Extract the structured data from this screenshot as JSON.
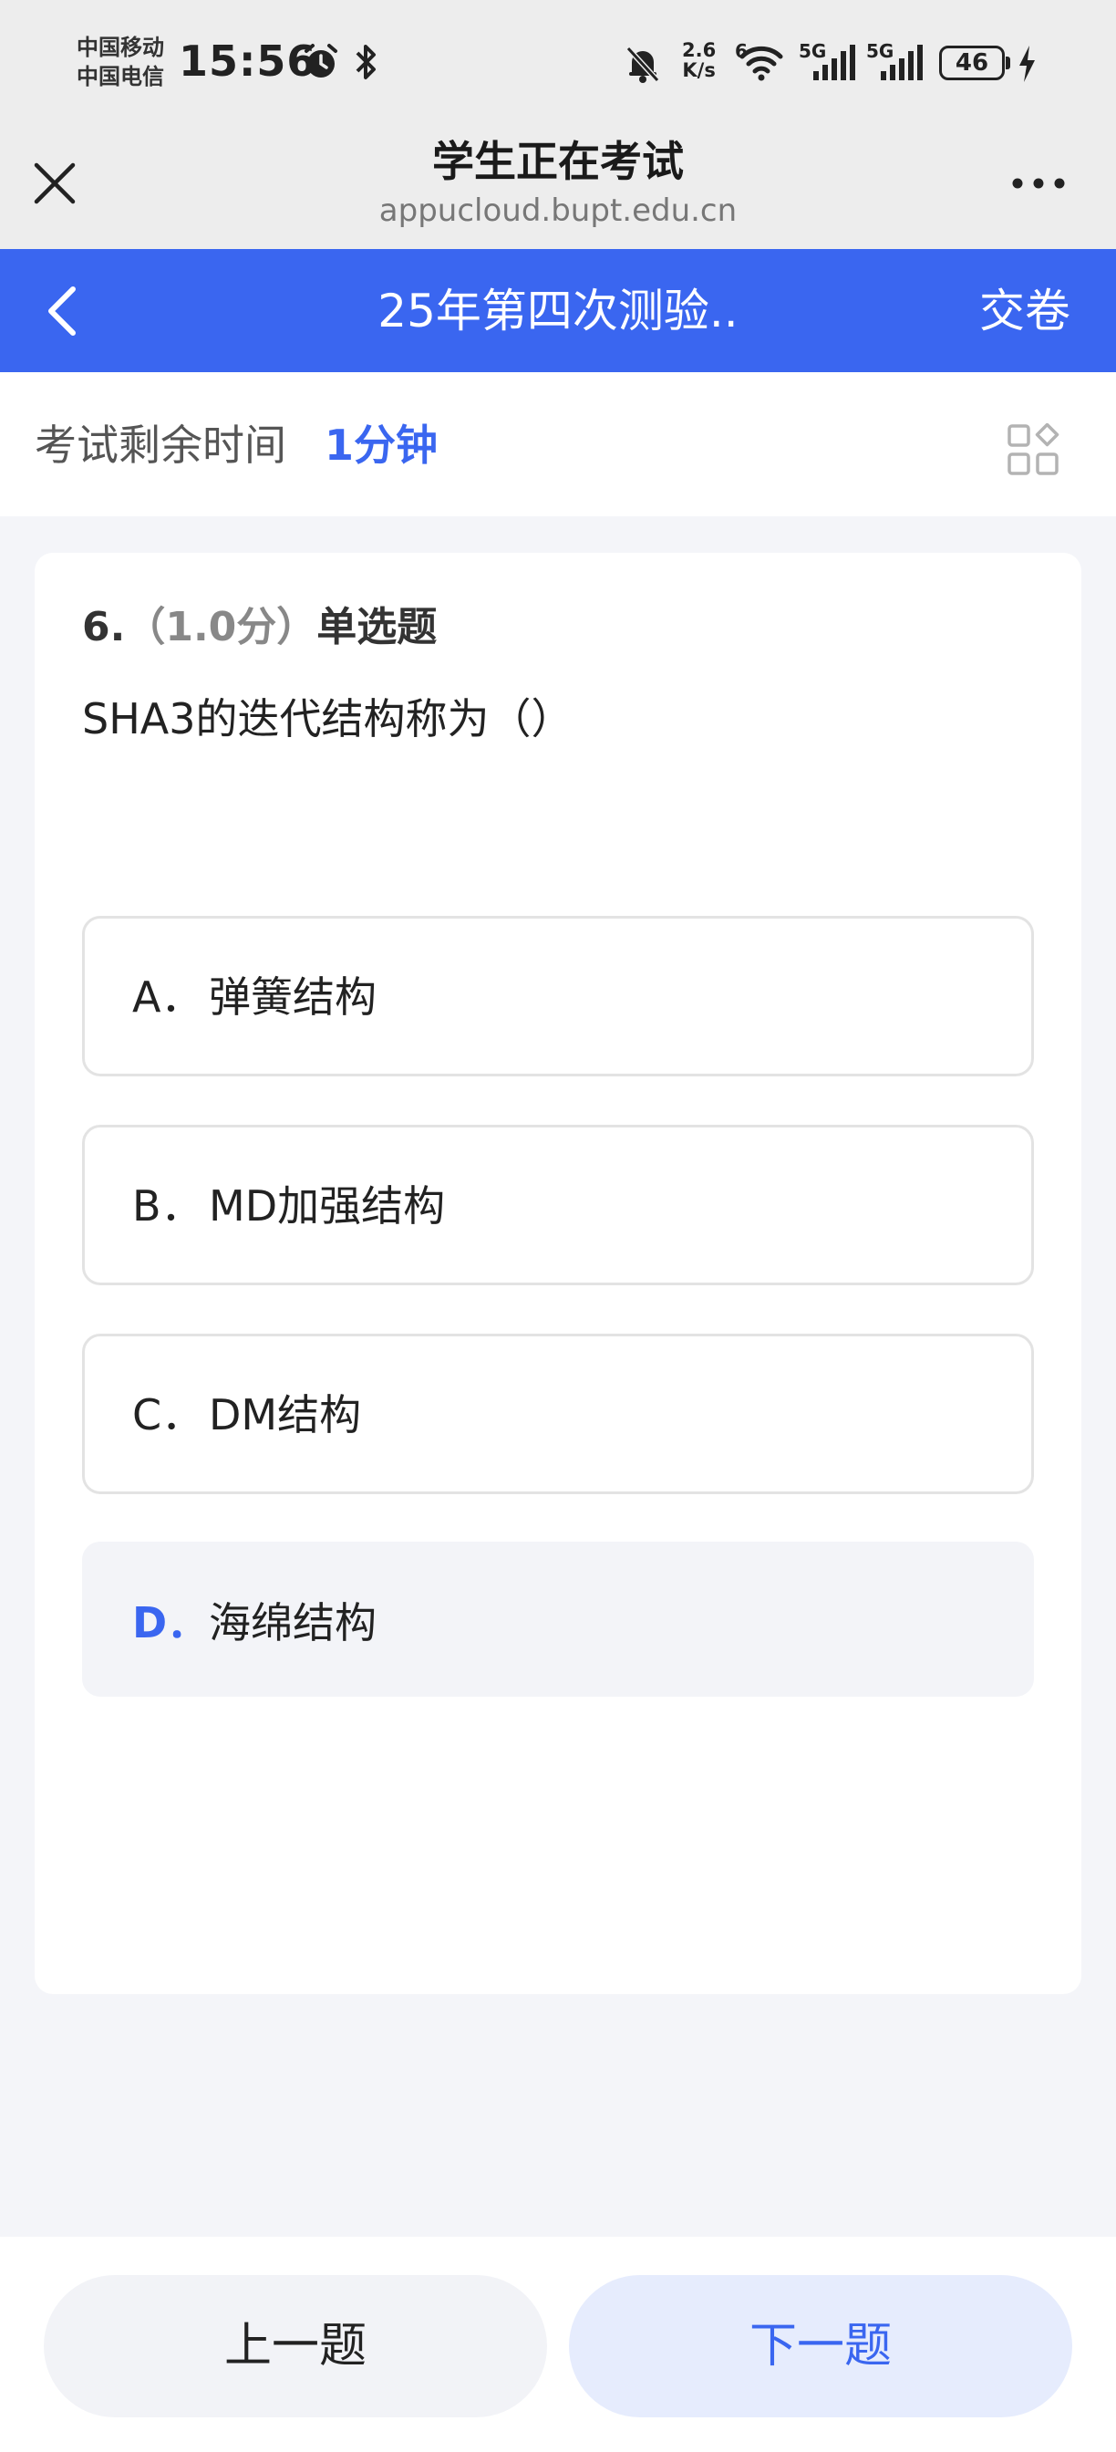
{
  "status_bar": {
    "carrier_1": "中国移动",
    "carrier_2": "中国电信",
    "time": "15:56",
    "net_speed_value": "2.6",
    "net_speed_unit": "K/s",
    "wifi_label": "6",
    "sim1_label": "5G",
    "sim2_label": "5G",
    "battery": "46",
    "icons": [
      "alarm-icon",
      "bluetooth-icon",
      "mute-bell-icon",
      "wifi-icon",
      "signal-icon",
      "signal-icon",
      "battery-icon",
      "charging-icon"
    ]
  },
  "browser": {
    "title": "学生正在考试",
    "url": "appucloud.bupt.edu.cn"
  },
  "nav": {
    "title": "25年第四次测验..",
    "submit_label": "交卷"
  },
  "timer": {
    "label": "考试剩余时间",
    "value": "1分钟"
  },
  "question": {
    "number": "6.",
    "score": "（1.0分）",
    "type": "单选题",
    "text": "SHA3的迭代结构称为（）",
    "options": [
      {
        "letter": "A．",
        "text": "弹簧结构",
        "selected": false
      },
      {
        "letter": "B．",
        "text": "MD加强结构",
        "selected": false
      },
      {
        "letter": "C．",
        "text": "DM结构",
        "selected": false
      },
      {
        "letter": "D．",
        "text": "海绵结构",
        "selected": true
      }
    ]
  },
  "footer": {
    "prev_label": "上一题",
    "next_label": "下一题"
  },
  "colors": {
    "accent": "#3a66f0",
    "next_button_bg": "#e6ecfd",
    "page_bg": "#f4f5f9"
  }
}
